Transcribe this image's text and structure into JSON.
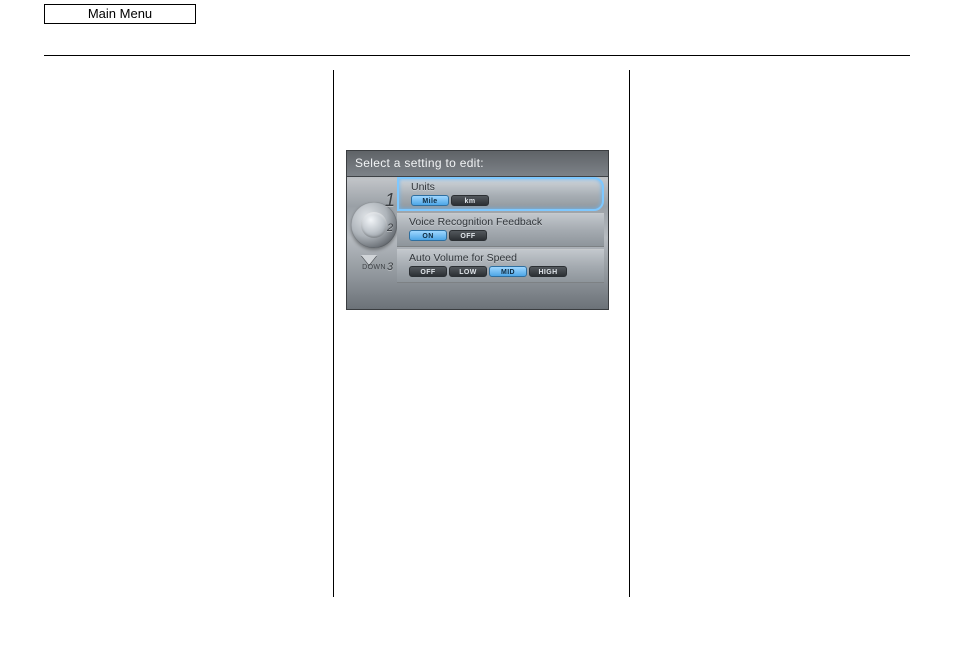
{
  "header": {
    "main_menu_label": "Main Menu"
  },
  "device": {
    "title": "Select a setting to edit:",
    "down_label": "DOWN",
    "rows": [
      {
        "num": "1",
        "label": "Units",
        "selected": true,
        "options": [
          {
            "label": "Mile",
            "active": true
          },
          {
            "label": "km",
            "active": false
          }
        ]
      },
      {
        "num": "2",
        "label": "Voice Recognition Feedback",
        "selected": false,
        "options": [
          {
            "label": "ON",
            "active": true
          },
          {
            "label": "OFF",
            "active": false
          }
        ]
      },
      {
        "num": "3",
        "label": "Auto Volume for Speed",
        "selected": false,
        "options": [
          {
            "label": "OFF",
            "active": false
          },
          {
            "label": "LOW",
            "active": false
          },
          {
            "label": "MID",
            "active": true
          },
          {
            "label": "HIGH",
            "active": false
          }
        ]
      }
    ]
  }
}
